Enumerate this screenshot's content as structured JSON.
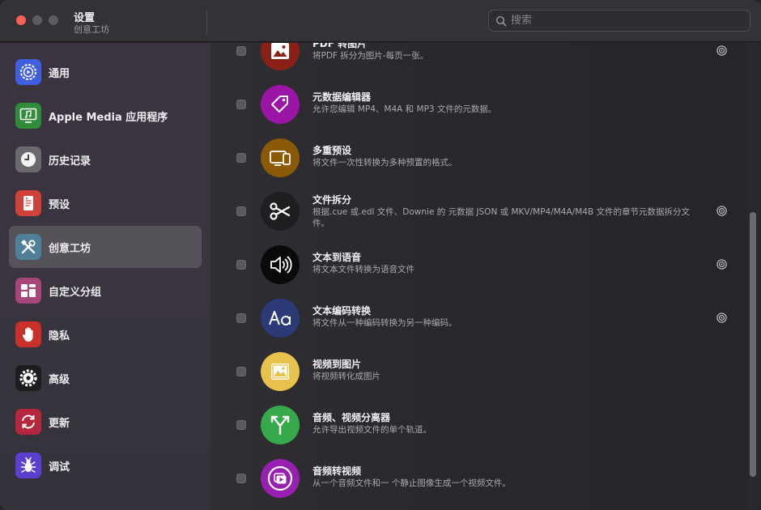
{
  "window": {
    "title": "设置",
    "subtitle": "创意工坊"
  },
  "search": {
    "placeholder": "搜索",
    "value": ""
  },
  "sidebar": {
    "items": [
      {
        "label": "通用",
        "icon": "gear-badge-icon",
        "color": "#3b5bdb",
        "active": false
      },
      {
        "label": "Apple Media 应用程序",
        "icon": "music-monitor-icon",
        "color": "#2f8d3a",
        "active": false
      },
      {
        "label": "历史记录",
        "icon": "clock-icon",
        "color": "#5e5e62",
        "active": false
      },
      {
        "label": "预设",
        "icon": "document-icon",
        "color": "#d0413a",
        "active": false
      },
      {
        "label": "创意工坊",
        "icon": "tools-icon",
        "color": "#4f7f99",
        "active": true
      },
      {
        "label": "自定义分组",
        "icon": "grid-icon",
        "color": "#a8457a",
        "active": false
      },
      {
        "label": "隐私",
        "icon": "hand-icon",
        "color": "#c8302a",
        "active": false
      },
      {
        "label": "高级",
        "icon": "advanced-gear-icon",
        "color": "#222224",
        "active": false
      },
      {
        "label": "更新",
        "icon": "refresh-icon",
        "color": "#b5273d",
        "active": false
      },
      {
        "label": "调试",
        "icon": "bug-icon",
        "color": "#5a3fd0",
        "active": false
      }
    ]
  },
  "workshop": {
    "items": [
      {
        "title": "PDF 转图片",
        "desc": "将PDF 拆分为图片-每页一张。",
        "icon": "image-icon",
        "color": "#8a2016",
        "has_settings": true,
        "checked": false
      },
      {
        "title": "元数据编辑器",
        "desc": "允许您编辑 MP4、M4A 和 MP3 文件的元数据。",
        "icon": "tag-icon",
        "color": "#9a14a6",
        "has_settings": false,
        "checked": false
      },
      {
        "title": "多重预设",
        "desc": "将文件一次性转换为多种预置的格式。",
        "icon": "devices-icon",
        "color": "#8a5a07",
        "has_settings": false,
        "checked": false
      },
      {
        "title": "文件拆分",
        "desc": "根据.cue 或.edl 文件、Downie 的 元数据 JSON 或 MKV/MP4/M4A/M4B 文件的章节元数据拆分文件。",
        "icon": "scissors-icon",
        "color": "#1f1f22",
        "has_settings": true,
        "checked": false
      },
      {
        "title": "文本到语音",
        "desc": "将文本文件转换为语音文件",
        "icon": "speaker-icon",
        "color": "#0a0a0b",
        "has_settings": true,
        "checked": false
      },
      {
        "title": "文本编码转换",
        "desc": "将文件从一种编码转换为另一种编码。",
        "icon": "text-encoding-icon",
        "color": "#2c3a78",
        "has_settings": true,
        "checked": false
      },
      {
        "title": "视频到图片",
        "desc": "将视频转化成图片",
        "icon": "picture-icon",
        "color": "#e9c24e",
        "has_settings": false,
        "checked": false
      },
      {
        "title": "音频、视频分离器",
        "desc": "允许导出视频文件的单个轨道。",
        "icon": "split-arrow-icon",
        "color": "#36a94a",
        "has_settings": false,
        "checked": false
      },
      {
        "title": "音频转视频",
        "desc": "从一个音频文件和一 个静止图像生成一个视频文件。",
        "icon": "audio-video-icon",
        "color": "#9820b0",
        "has_settings": false,
        "checked": false
      }
    ]
  }
}
